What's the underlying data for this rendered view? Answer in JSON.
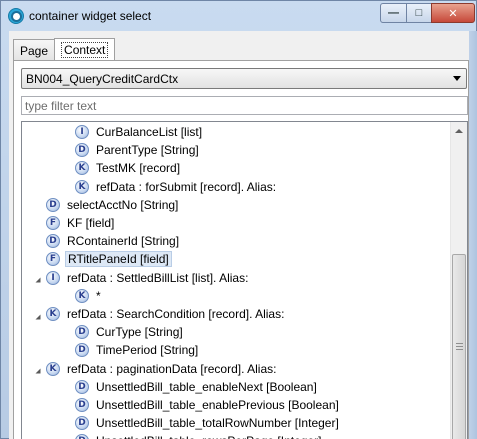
{
  "window": {
    "title": "container widget select",
    "controls": {
      "minimize": "—",
      "maximize": "□",
      "close": "✕"
    }
  },
  "tabs": [
    {
      "label": "Page",
      "active": false
    },
    {
      "label": "Context",
      "active": true
    }
  ],
  "context_select": {
    "value": "BN004_QueryCreditCardCtx"
  },
  "filter": {
    "placeholder": "type filter text",
    "value": ""
  },
  "tree": {
    "rows": [
      {
        "icon": "I",
        "icon_name": "list-icon",
        "label": "CurBalanceList [list]",
        "level": 2,
        "expander": "",
        "selected": false
      },
      {
        "icon": "D",
        "icon_name": "data-field-icon",
        "label": "ParentType [String]",
        "level": 2,
        "expander": "",
        "selected": false
      },
      {
        "icon": "K",
        "icon_name": "record-icon",
        "label": "TestMK [record]",
        "level": 2,
        "expander": "",
        "selected": false
      },
      {
        "icon": "K",
        "icon_name": "record-icon",
        "label": "refData : forSubmit [record]. Alias:",
        "level": 2,
        "expander": "",
        "selected": false
      },
      {
        "icon": "D",
        "icon_name": "data-field-icon",
        "label": "selectAcctNo [String]",
        "level": 1,
        "expander": "",
        "selected": false
      },
      {
        "icon": "F",
        "icon_name": "field-icon",
        "label": "KF [field]",
        "level": 1,
        "expander": "",
        "selected": false
      },
      {
        "icon": "D",
        "icon_name": "data-field-icon",
        "label": "RContainerId [String]",
        "level": 1,
        "expander": "",
        "selected": false
      },
      {
        "icon": "F",
        "icon_name": "field-icon",
        "label": "RTitlePaneId [field]",
        "level": 1,
        "expander": "",
        "selected": true
      },
      {
        "icon": "I",
        "icon_name": "list-icon",
        "label": "refData : SettledBillList [list]. Alias:",
        "level": 1,
        "expander": "open",
        "selected": false
      },
      {
        "icon": "K",
        "icon_name": "record-icon",
        "label": "*",
        "level": 2,
        "expander": "",
        "selected": false
      },
      {
        "icon": "K",
        "icon_name": "record-icon",
        "label": "refData : SearchCondition [record]. Alias:",
        "level": 1,
        "expander": "open",
        "selected": false
      },
      {
        "icon": "D",
        "icon_name": "data-field-icon",
        "label": "CurType [String]",
        "level": 2,
        "expander": "",
        "selected": false
      },
      {
        "icon": "D",
        "icon_name": "data-field-icon",
        "label": "TimePeriod [String]",
        "level": 2,
        "expander": "",
        "selected": false
      },
      {
        "icon": "K",
        "icon_name": "record-icon",
        "label": "refData : paginationData [record]. Alias:",
        "level": 1,
        "expander": "open",
        "selected": false
      },
      {
        "icon": "D",
        "icon_name": "data-field-icon",
        "label": "UnsettledBill_table_enableNext [Boolean]",
        "level": 2,
        "expander": "",
        "selected": false
      },
      {
        "icon": "D",
        "icon_name": "data-field-icon",
        "label": "UnsettledBill_table_enablePrevious [Boolean]",
        "level": 2,
        "expander": "",
        "selected": false
      },
      {
        "icon": "D",
        "icon_name": "data-field-icon",
        "label": "UnsettledBill_table_totalRowNumber [Integer]",
        "level": 2,
        "expander": "",
        "selected": false
      },
      {
        "icon": "D",
        "icon_name": "data-field-icon",
        "label": "UnsettledBill_table_rowsPerPage [Integer]",
        "level": 2,
        "expander": "",
        "selected": false
      }
    ]
  }
}
